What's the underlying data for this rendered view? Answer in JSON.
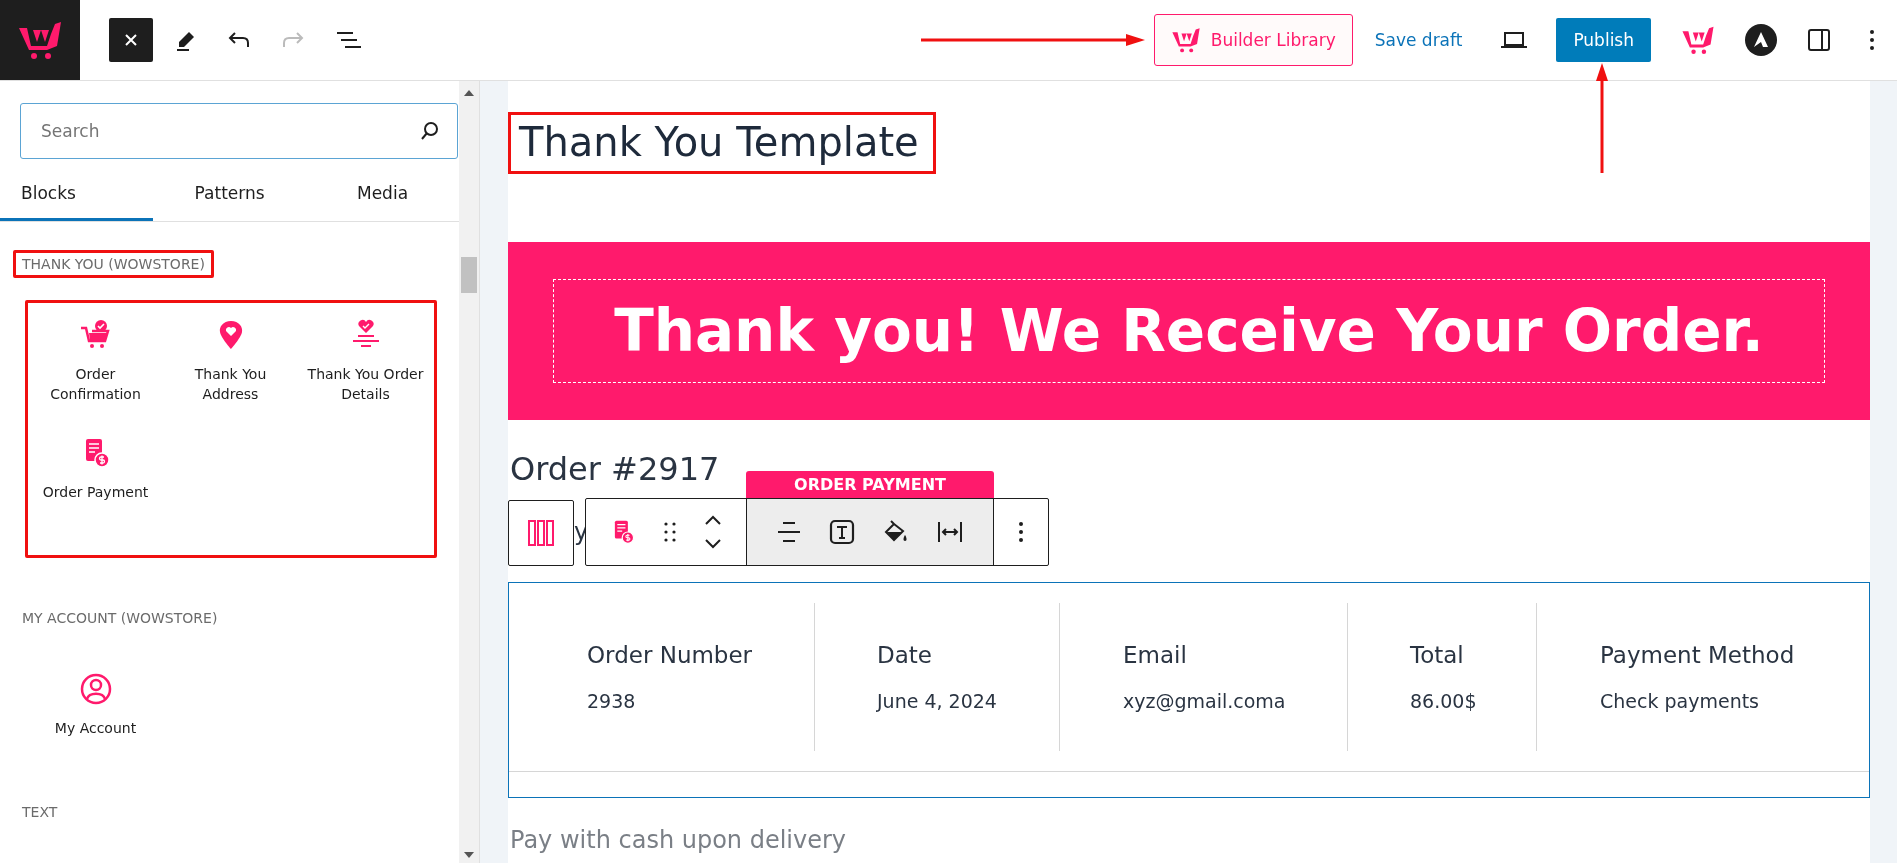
{
  "header": {
    "builder_library": "Builder Library",
    "builder_library_annotated": true,
    "save_draft": "Save draft",
    "publish": "Publish",
    "publish_annotated": true
  },
  "sidebar": {
    "search": {
      "placeholder": "Search"
    },
    "tabs": [
      {
        "label": "Blocks",
        "selected": true
      },
      {
        "label": "Patterns",
        "selected": false
      },
      {
        "label": "Media",
        "selected": false
      }
    ],
    "sections": [
      {
        "title": "THANK YOU (WOWSTORE)",
        "highlighted": true,
        "blocks": [
          {
            "label": "Order Confirmation",
            "kind": "confirmation"
          },
          {
            "label": "Thank You Address",
            "kind": "address"
          },
          {
            "label": "Thank You Order Details",
            "kind": "details"
          },
          {
            "label": "Order Payment",
            "kind": "payment"
          }
        ]
      },
      {
        "title": "MY ACCOUNT (WOWSTORE)",
        "highlighted": false,
        "blocks": [
          {
            "label": "My Account",
            "kind": "account"
          }
        ]
      },
      {
        "title": "TEXT",
        "highlighted": false
      }
    ]
  },
  "canvas": {
    "title": "Thank You Template",
    "title_highlighted": true,
    "banner": "Thank you! We Receive Your Order.",
    "order_heading": "Order #2917",
    "partial_text": "y",
    "block_toolbar": {
      "label": "ORDER PAYMENT"
    },
    "order_table": {
      "columns": [
        {
          "heading": "Order Number",
          "value": "2938"
        },
        {
          "heading": "Date",
          "value": "June 4, 2024"
        },
        {
          "heading": "Email",
          "value": "xyz@gmail.coma"
        },
        {
          "heading": "Total",
          "value": "86.00$"
        },
        {
          "heading": "Payment Method",
          "value": "Check payments"
        }
      ]
    },
    "payment_note": "Pay with cash upon delivery"
  }
}
